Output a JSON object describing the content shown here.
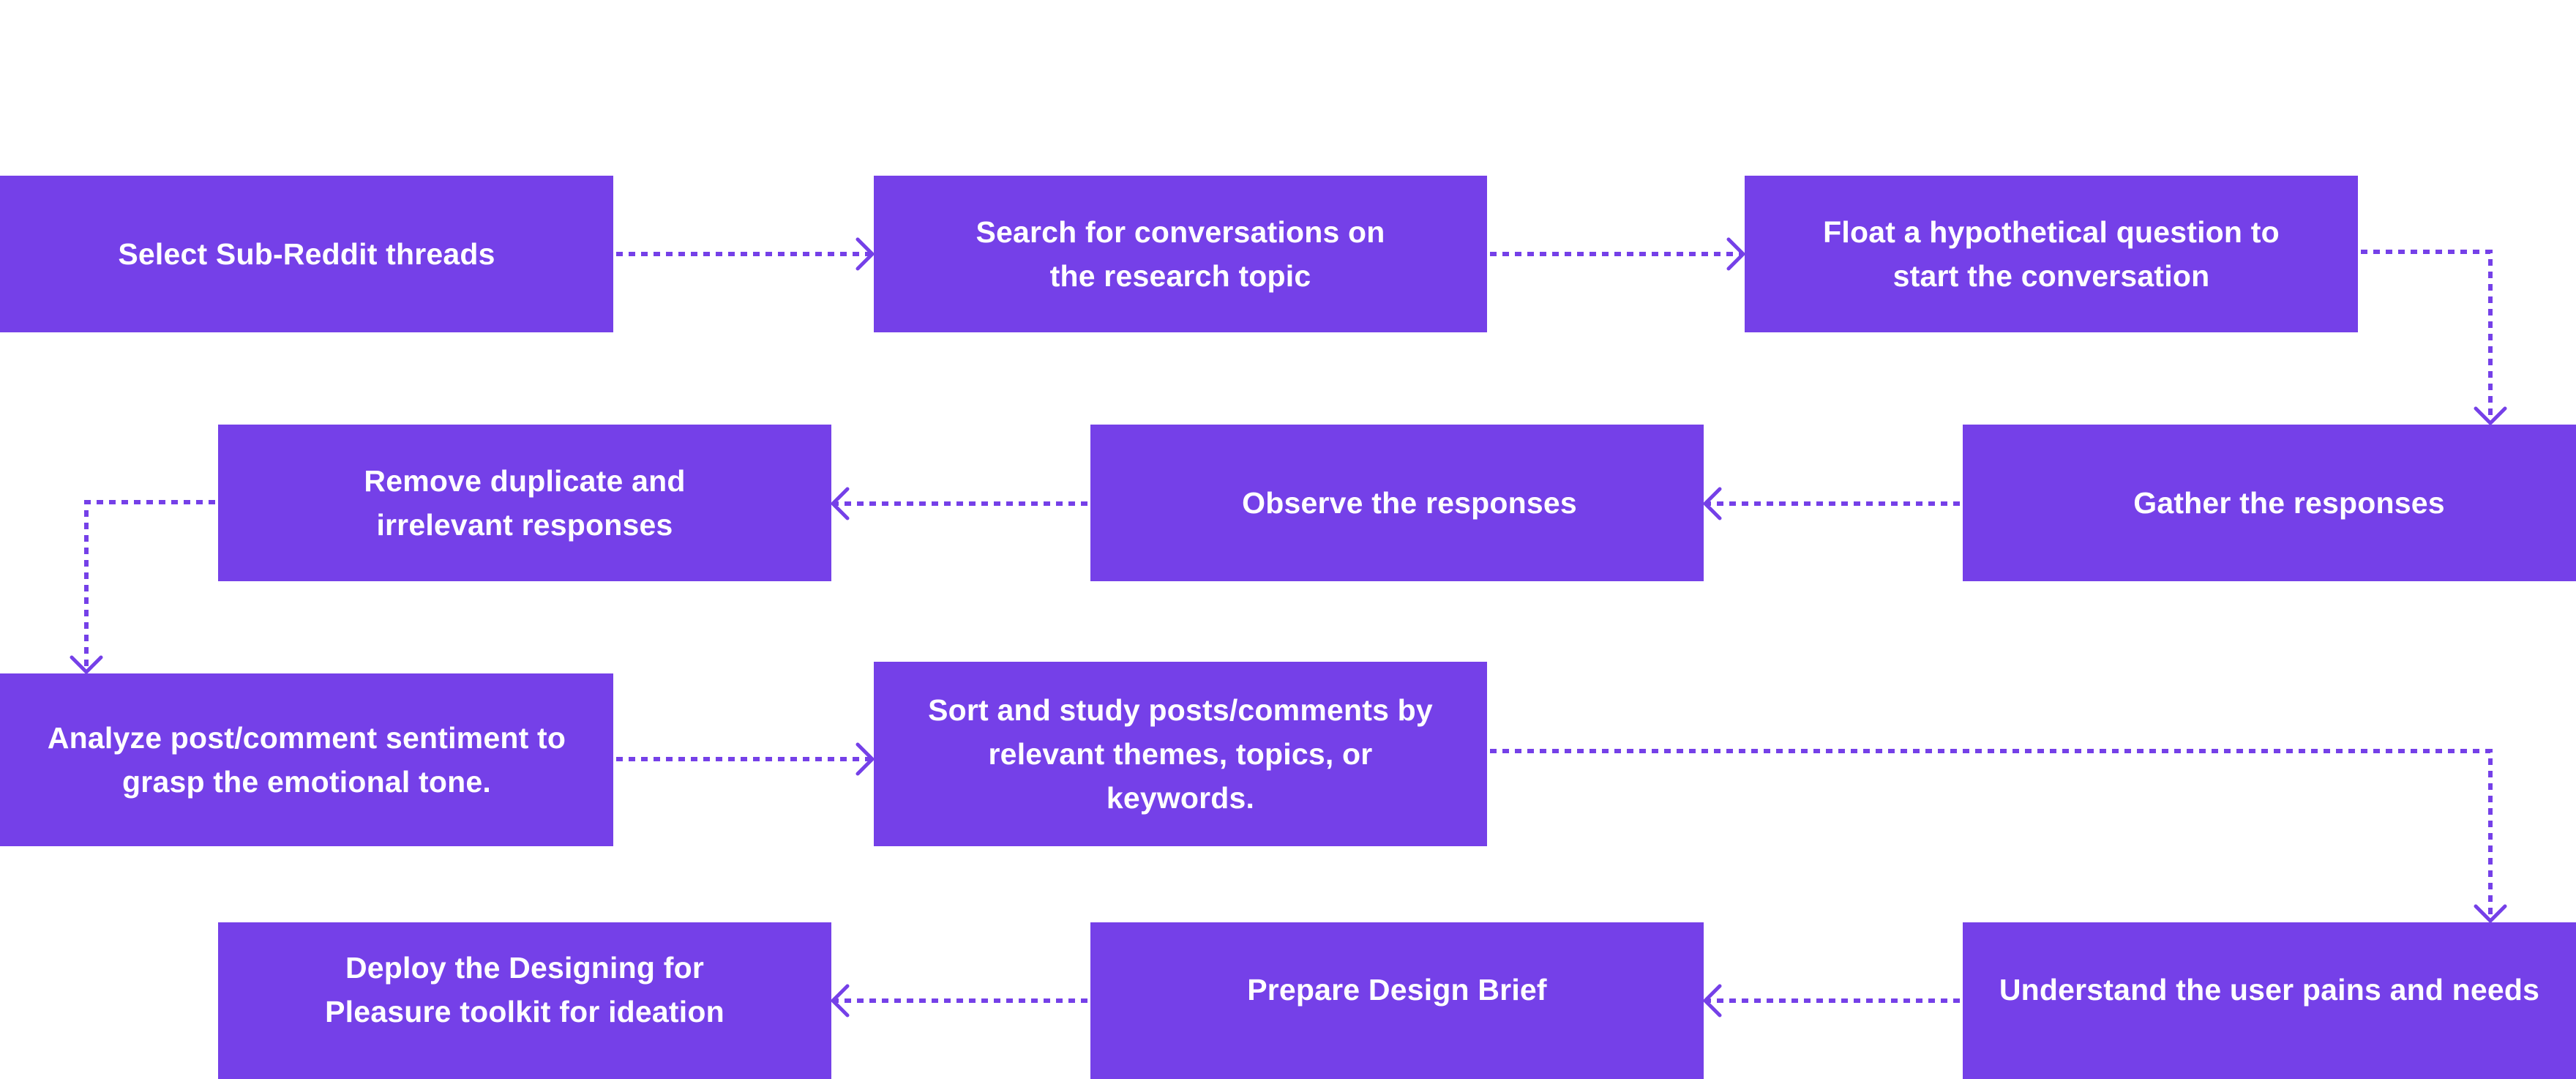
{
  "diagram": {
    "title": "",
    "accent_color": "#7540E8",
    "text_color": "#FFFFFF",
    "background_color": "#FFFFFF",
    "steps": [
      {
        "id": "s1",
        "label": "Select Sub-Reddit threads"
      },
      {
        "id": "s2",
        "label": "Search for conversations on\nthe research topic"
      },
      {
        "id": "s3",
        "label": "Float a hypothetical question to\nstart the conversation"
      },
      {
        "id": "s4",
        "label": "Gather the responses"
      },
      {
        "id": "s5",
        "label": "Observe the responses"
      },
      {
        "id": "s6",
        "label": "Remove duplicate and\nirrelevant responses"
      },
      {
        "id": "s7",
        "label": "Analyze post/comment sentiment to\ngrasp the emotional tone."
      },
      {
        "id": "s8",
        "label": "Sort and study posts/comments by\nrelevant themes, topics, or\nkeywords."
      },
      {
        "id": "s9",
        "label": "Understand the user pains and needs"
      },
      {
        "id": "s10",
        "label": "Prepare Design Brief"
      },
      {
        "id": "s11",
        "label": "Deploy the Designing for\nPleasure toolkit for ideation"
      }
    ],
    "connections": [
      {
        "from": "s1",
        "to": "s2",
        "style": "dashed",
        "arrow": "open-chevron"
      },
      {
        "from": "s2",
        "to": "s3",
        "style": "dashed",
        "arrow": "open-chevron"
      },
      {
        "from": "s3",
        "to": "s4",
        "style": "dashed",
        "arrow": "open-chevron"
      },
      {
        "from": "s4",
        "to": "s5",
        "style": "dashed",
        "arrow": "open-chevron"
      },
      {
        "from": "s5",
        "to": "s6",
        "style": "dashed",
        "arrow": "open-chevron"
      },
      {
        "from": "s6",
        "to": "s7",
        "style": "dashed",
        "arrow": "open-chevron"
      },
      {
        "from": "s7",
        "to": "s8",
        "style": "dashed",
        "arrow": "open-chevron"
      },
      {
        "from": "s8",
        "to": "s9",
        "style": "dashed",
        "arrow": "open-chevron"
      },
      {
        "from": "s9",
        "to": "s10",
        "style": "dashed",
        "arrow": "open-chevron"
      },
      {
        "from": "s10",
        "to": "s11",
        "style": "dashed",
        "arrow": "open-chevron"
      }
    ]
  }
}
